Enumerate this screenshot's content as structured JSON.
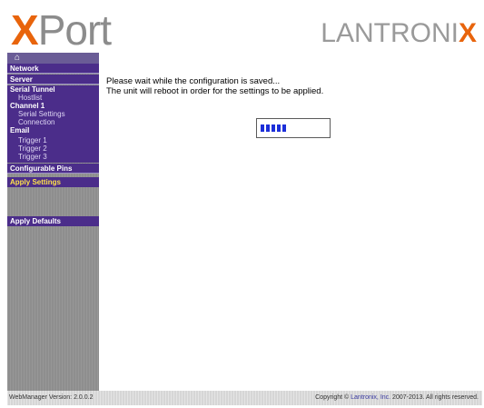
{
  "header": {
    "logo_xport_x": "X",
    "logo_xport_rest": "Port",
    "logo_lantronix_main": "LANTRONI",
    "logo_lantronix_x": "X"
  },
  "sidebar": {
    "home_icon": "home-icon",
    "items": [
      {
        "label": "Network"
      },
      {
        "label": "Server"
      },
      {
        "label": "Serial Tunnel"
      },
      {
        "label": "Hostlist"
      },
      {
        "label": "Channel 1"
      },
      {
        "label": "Serial Settings"
      },
      {
        "label": "Connection"
      },
      {
        "label": "Email"
      },
      {
        "label": "Trigger 1"
      },
      {
        "label": "Trigger 2"
      },
      {
        "label": "Trigger 3"
      },
      {
        "label": "Configurable Pins"
      },
      {
        "label": "Apply Settings"
      },
      {
        "label": "Apply Defaults"
      }
    ]
  },
  "main": {
    "message_line1": "Please wait while the configuration is saved...",
    "message_line2": "The unit will reboot in order for the settings to be applied.",
    "progress_blocks_filled": 5
  },
  "footer": {
    "version": "WebManager Version: 2.0.0.2",
    "copyright_prefix": "Copyright © ",
    "copyright_link": "Lantronix, Inc.",
    "copyright_suffix": " 2007-2013. All rights reserved."
  },
  "colors": {
    "nav_bg": "#4b2d8a",
    "accent_orange": "#e8640c",
    "apply_settings_text": "#ffe34a",
    "progress_blue": "#1c2fd9"
  }
}
